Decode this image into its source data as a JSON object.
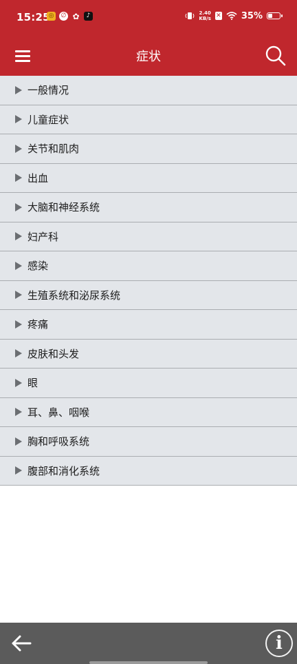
{
  "status_bar": {
    "time": "15:25",
    "net_speed_value": "2.40",
    "net_speed_unit": "KB/s",
    "battery_percent_text": "35%",
    "battery_level": 0.35
  },
  "app_bar": {
    "title": "症状",
    "menu_icon": "hamburger-menu-icon",
    "search_icon": "search-icon"
  },
  "categories": [
    "一般情况",
    "儿童症状",
    "关节和肌肉",
    "出血",
    "大脑和神经系统",
    "妇产科",
    "感染",
    "生殖系统和泌尿系统",
    "疼痛",
    "皮肤和头发",
    "眼",
    "耳、鼻、咽喉",
    "胸和呼吸系统",
    "腹部和消化系统"
  ],
  "bottom_bar": {
    "back_icon": "back-arrow-icon",
    "info_label": "i"
  },
  "colors": {
    "primary": "#c0272d",
    "list_bg": "#e3e6ea",
    "bottom_bar": "#5b5b5b"
  }
}
